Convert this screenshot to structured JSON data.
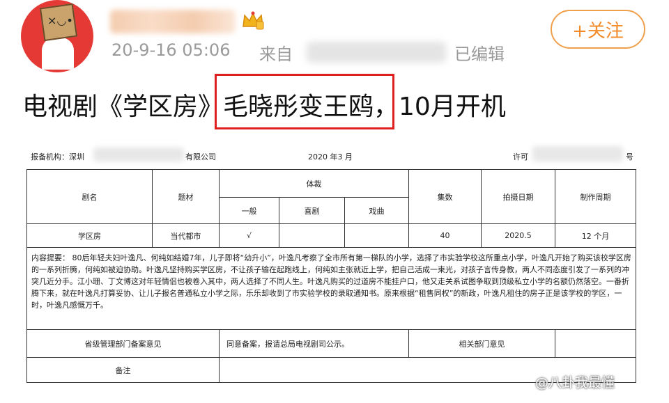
{
  "post": {
    "timestamp": "20-9-16 05:06",
    "source_prefix": "来自",
    "edited_label": "已编辑",
    "follow_label": "+关注",
    "headline_before": "电视剧《学区房》",
    "headline_highlight": "毛晓彤变王鸥",
    "headline_after": "，10月开机"
  },
  "document": {
    "org_label": "报备机构：深圳",
    "org_suffix": "有限公司",
    "date": "2020 年3 月",
    "license_prefix": "许可",
    "license_suffix": "号",
    "headers": {
      "title": "剧名",
      "theme": "题材",
      "genre": "体裁",
      "genre_general": "一般",
      "genre_comedy": "喜剧",
      "genre_opera": "戏曲",
      "episodes": "集数",
      "shoot_date": "拍摄日期",
      "production_cycle": "制作周期"
    },
    "row": {
      "title": "学区房",
      "theme": "当代都市",
      "general_mark": "√",
      "comedy_mark": "",
      "opera_mark": "",
      "episodes": "40",
      "shoot_date": "2020.5",
      "production_cycle": "12 个月"
    },
    "summary": "内容提要： 80后年轻夫妇叶逸凡、何纯如结婚7年，儿子即将“幼升小”，叶逸凡考察了全市所有第一梯队的小学，选择了市实验学校这所重点小学，叶逸凡开始了购买该校学区房的一系列折腾，何纯如被迫协助。叶逸凡坚持购买学区房，不让孩子输在起跑线上，何纯如主张就近上学，把自己活成一束光，对孩子言传身教，两人不同态度引发了一系列的冲突几近分手。江小珊、丁文博这对年轻情侣也被卷入其中，两人选择了不同人生。叶逸凡购买的过道房不能挂户口，他又走关系试图争取到顶级私立小学的名额仍然落空。一番折腾下来，就在叶逸凡打算妥协、让儿子报名普通私立小学之际，乐乐却收到了市实验学校的录取通知书。原来根据“租售同权”的新政，叶逸凡租住的房子正是该学校的学区，一时，叶逸凡感慨万千。",
    "provincial_label": "省级管理部门备案意见",
    "provincial_opinion": "同意备案，报请总局电视剧司公示。",
    "related_label": "相关部门意见",
    "related_opinion": "",
    "remarks_label": "备注",
    "remarks_value": ""
  },
  "watermark": "@八卦我最懂",
  "colors": {
    "follow": "#f28b2a",
    "highlight_box": "#e02020",
    "meta_text": "#9a9a9a"
  }
}
